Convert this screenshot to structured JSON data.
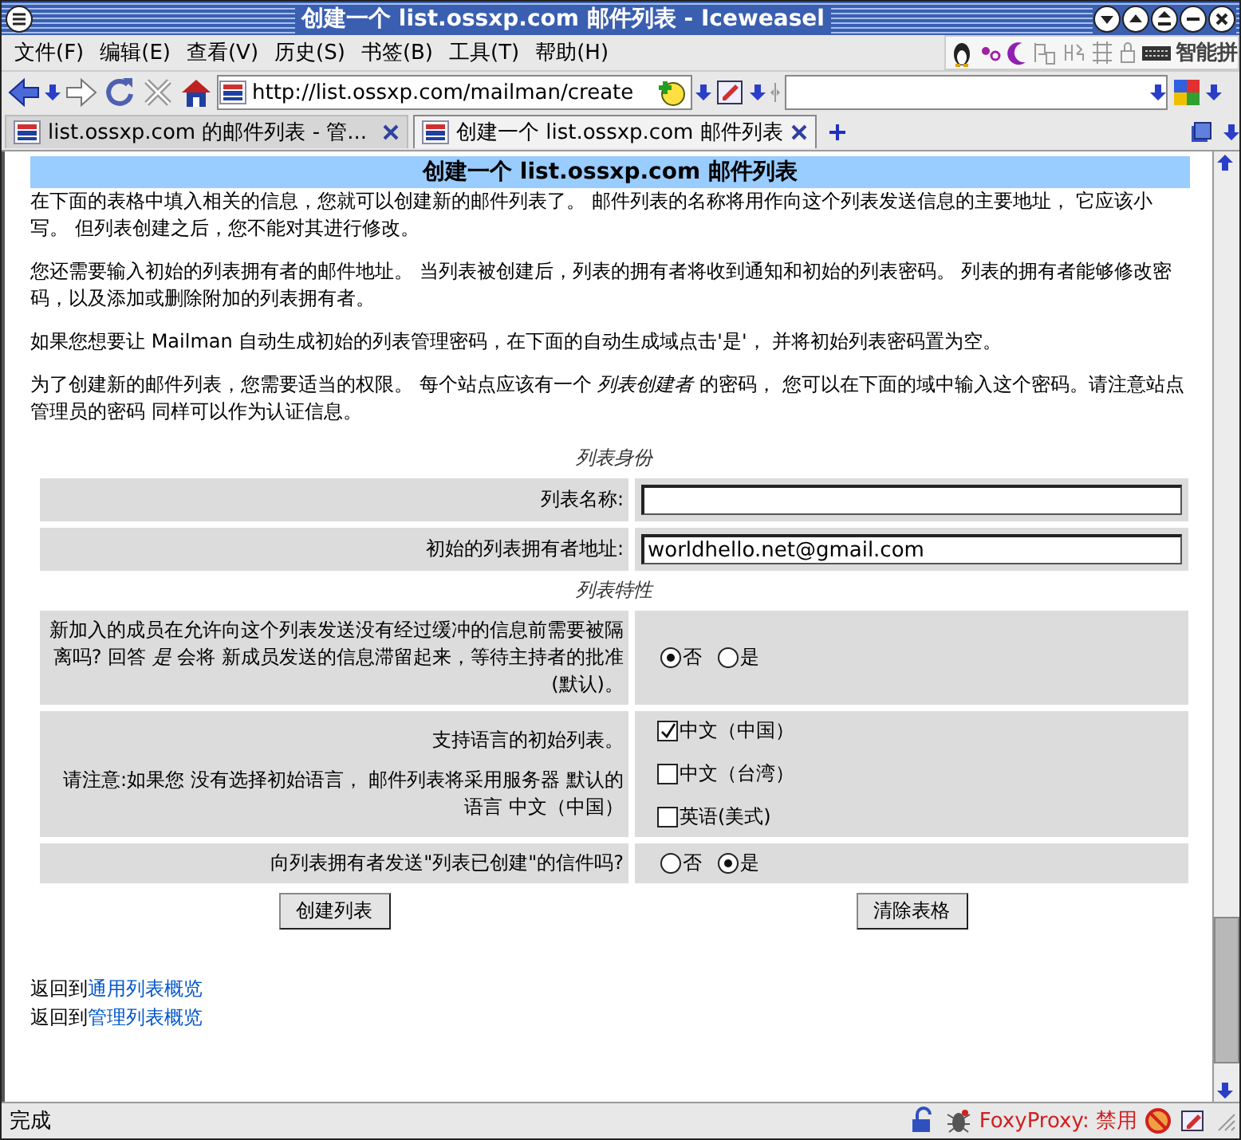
{
  "window": {
    "title": "创建一个 list.ossxp.com 邮件列表 - Iceweasel"
  },
  "menu": [
    "文件(F)",
    "编辑(E)",
    "查看(V)",
    "历史(S)",
    "书签(B)",
    "工具(T)",
    "帮助(H)"
  ],
  "ime_toolbar": {
    "label": "智能拼"
  },
  "toolbar": {
    "url": "http://list.ossxp.com/mailman/create"
  },
  "tabs": [
    {
      "label": "list.ossxp.com 的邮件列表 - 管...",
      "selected": false
    },
    {
      "label": "创建一个 list.ossxp.com 邮件列表",
      "selected": true
    }
  ],
  "page": {
    "heading": "创建一个 list.ossxp.com 邮件列表",
    "paragraphs": [
      "在下面的表格中填入相关的信息，您就可以创建新的邮件列表了。 邮件列表的名称将用作向这个列表发送信息的主要地址， 它应该小写。 但列表创建之后，您不能对其进行修改。",
      "您还需要输入初始的列表拥有者的邮件地址。 当列表被创建后，列表的拥有者将收到通知和初始的列表密码。 列表的拥有者能够修改密码，以及添加或删除附加的列表拥有者。",
      "如果您想要让 Mailman 自动生成初始的列表管理密码，在下面的自动生成域点击'是'， 并将初始列表密码置为空。",
      "为了创建新的邮件列表，您需要适当的权限。 每个站点应该有一个 *列表创建者* 的密码， 您可以在下面的域中输入这个密码。请注意站点管理员的密码 同样可以作为认证信息。"
    ],
    "sections": [
      {
        "title": "列表身份",
        "rows": [
          {
            "kind": "text",
            "label": "列表名称:"
          },
          {
            "kind": "text",
            "label": "初始的列表拥有者地址:",
            "value": "worldhello.net@gmail.com"
          }
        ]
      },
      {
        "title": "列表特性",
        "rows": [
          {
            "kind": "radio",
            "label": "新加入的成员在允许向这个列表发送没有经过缓冲的信息前需要被隔离吗? 回答 *是* 会将 新成员发送的信息滞留起来，等待主持者的批准(默认)。",
            "options": [
              {
                "label": "否",
                "selected": true
              },
              {
                "label": "是",
                "selected": false
              }
            ]
          },
          {
            "kind": "checkboxes",
            "label": "支持语言的初始列表。",
            "note": "请注意:如果您 没有选择初始语言， 邮件列表将采用服务器 默认的语言 中文（中国）",
            "options": [
              {
                "label": "中文（中国）",
                "checked": true
              },
              {
                "label": "中文（台湾）",
                "checked": false
              },
              {
                "label": "英语(美式)",
                "checked": false
              }
            ]
          },
          {
            "kind": "radio",
            "label": "向列表拥有者发送\"列表已创建\"的信件吗?",
            "options": [
              {
                "label": "否",
                "selected": false
              },
              {
                "label": "是",
                "selected": true
              }
            ]
          }
        ]
      }
    ],
    "buttons": [
      "创建列表",
      "清除表格"
    ],
    "links": [
      {
        "prefix": "返回到",
        "link": "通用列表概览"
      },
      {
        "prefix": "返回到",
        "link": "管理列表概览"
      }
    ]
  },
  "status_bar": {
    "text": "完成",
    "proxy": "FoxyProxy: 禁用"
  }
}
